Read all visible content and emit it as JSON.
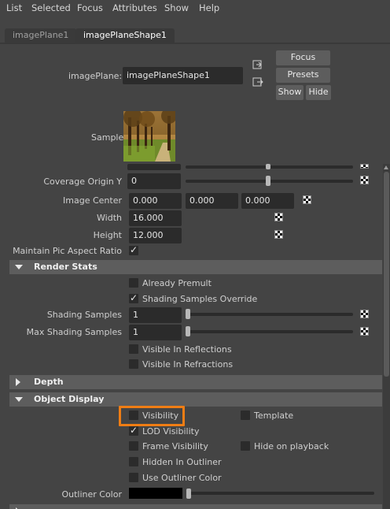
{
  "menu": [
    "List",
    "Selected",
    "Focus",
    "Attributes",
    "Show",
    "Help"
  ],
  "tabs": [
    "imagePlane1",
    "imagePlaneShape1"
  ],
  "header": {
    "image_plane_label": "imagePlane:",
    "image_plane_value": "imagePlaneShape1",
    "focus_label": "Focus",
    "presets_label": "Presets",
    "show_label": "Show",
    "hide_label": "Hide",
    "sample_label": "Sample"
  },
  "attrs": {
    "coverage_origin_y_label": "Coverage Origin Y",
    "coverage_origin_y_value": "0",
    "image_center_label": "Image Center",
    "image_center_x": "0.000",
    "image_center_y": "0.000",
    "image_center_z": "0.000",
    "width_label": "Width",
    "width_value": "16.000",
    "height_label": "Height",
    "height_value": "12.000",
    "maintain_aspect_label": "Maintain Pic Aspect Ratio",
    "maintain_aspect_checked": true
  },
  "render_stats": {
    "title": "Render Stats",
    "already_premult": "Already Premult",
    "already_premult_checked": false,
    "shading_samples_override": "Shading Samples Override",
    "shading_samples_override_checked": true,
    "shading_samples_label": "Shading Samples",
    "shading_samples_value": "1",
    "max_shading_samples_label": "Max Shading Samples",
    "max_shading_samples_value": "1",
    "visible_in_reflections": "Visible In Reflections",
    "visible_in_refractions": "Visible In Refractions"
  },
  "depth": {
    "title": "Depth"
  },
  "object_display": {
    "title": "Object Display",
    "visibility": "Visibility",
    "visibility_checked": false,
    "template": "Template",
    "lod_visibility": "LOD Visibility",
    "lod_visibility_checked": true,
    "frame_visibility": "Frame Visibility",
    "hide_on_playback": "Hide on playback",
    "hidden_in_outliner": "Hidden In Outliner",
    "use_outliner_color": "Use Outliner Color",
    "outliner_color_label": "Outliner Color",
    "outliner_color": "#000000"
  },
  "colors": {
    "highlight": "#ef7d14",
    "panel": "#444444",
    "section": "#5d5d5d",
    "field": "#2b2b2b"
  }
}
